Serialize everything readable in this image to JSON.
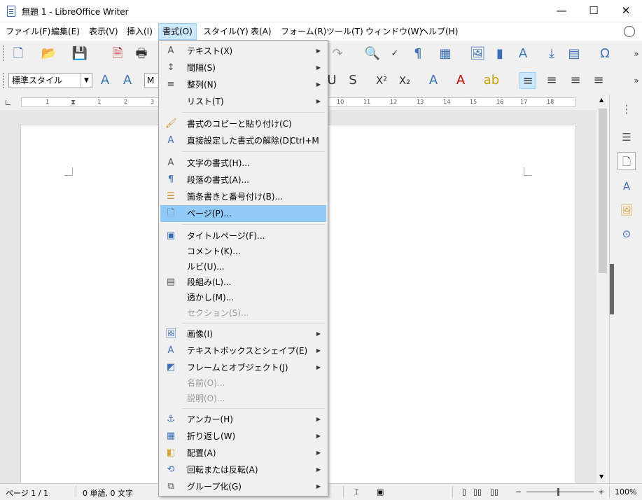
{
  "window": {
    "title": "無題 1 - LibreOffice Writer",
    "minimize": "—",
    "maximize": "☐",
    "close": "✕"
  },
  "menubar": [
    {
      "label": "ファイル(F)"
    },
    {
      "label": "編集(E)"
    },
    {
      "label": "表示(V)"
    },
    {
      "label": "挿入(I)"
    },
    {
      "label": "書式(O)"
    },
    {
      "label": "スタイル(Y)"
    },
    {
      "label": "表(A)"
    },
    {
      "label": "フォーム(R)"
    },
    {
      "label": "ツール(T)"
    },
    {
      "label": "ウィンドウ(W)"
    },
    {
      "label": "ヘルプ(H)"
    }
  ],
  "toolbar2": {
    "paragraph_style": "標準スタイル",
    "font_name": "M"
  },
  "ruler": {
    "numbers": [
      "1",
      "1",
      "2",
      "3",
      "10",
      "11",
      "12",
      "13",
      "14",
      "15",
      "16",
      "17",
      "18"
    ]
  },
  "format_menu": {
    "items": [
      {
        "icon": "text-icon",
        "glyph": "A",
        "label": "テキスト(X)",
        "submenu": true
      },
      {
        "icon": "spacing-icon",
        "glyph": "↕",
        "label": "間隔(S)",
        "submenu": true
      },
      {
        "icon": "align-icon",
        "glyph": "≡",
        "label": "整列(N)",
        "submenu": true
      },
      {
        "icon": "list-icon",
        "glyph": "",
        "label": "リスト(T)",
        "submenu": true
      },
      {
        "icon": "clone-formatting-icon",
        "glyph": "🖌",
        "label": "書式のコピーと貼り付け(C)"
      },
      {
        "icon": "clear-formatting-icon",
        "glyph": "A",
        "label": "直接設定した書式の解除(D)",
        "shortcut": "Ctrl+M"
      },
      {
        "icon": "character-icon",
        "glyph": "A",
        "label": "文字の書式(H)..."
      },
      {
        "icon": "paragraph-icon",
        "glyph": "¶",
        "label": "段落の書式(A)..."
      },
      {
        "icon": "bullets-numbering-icon",
        "glyph": "☰",
        "label": "箇条書きと番号付け(B)..."
      },
      {
        "icon": "page-icon",
        "glyph": "🗋",
        "label": "ページ(P)...",
        "highlight": true
      },
      {
        "icon": "title-page-icon",
        "glyph": "▣",
        "label": "タイトルページ(F)..."
      },
      {
        "icon": "",
        "glyph": "",
        "label": "コメント(K)..."
      },
      {
        "icon": "",
        "glyph": "",
        "label": "ルビ(U)..."
      },
      {
        "icon": "columns-icon",
        "glyph": "▤",
        "label": "段組み(L)..."
      },
      {
        "icon": "",
        "glyph": "",
        "label": "透かし(M)..."
      },
      {
        "icon": "",
        "glyph": "",
        "label": "セクション(S)...",
        "disabled": true
      },
      {
        "icon": "image-icon",
        "glyph": "🖼",
        "label": "画像(I)",
        "submenu": true
      },
      {
        "icon": "textbox-icon",
        "glyph": "A",
        "label": "テキストボックスとシェイプ(E)",
        "submenu": true
      },
      {
        "icon": "frame-icon",
        "glyph": "◩",
        "label": "フレームとオブジェクト(J)",
        "submenu": true
      },
      {
        "icon": "",
        "glyph": "",
        "label": "名前(O)...",
        "disabled": true
      },
      {
        "icon": "",
        "glyph": "",
        "label": "説明(O)...",
        "disabled": true
      },
      {
        "icon": "anchor-icon",
        "glyph": "⚓",
        "label": "アンカー(H)",
        "submenu": true
      },
      {
        "icon": "wrap-icon",
        "glyph": "▦",
        "label": "折り返し(W)",
        "submenu": true
      },
      {
        "icon": "arrange-icon",
        "glyph": "◧",
        "label": "配置(A)",
        "submenu": true
      },
      {
        "icon": "rotate-flip-icon",
        "glyph": "⟲",
        "label": "回転または反転(A)",
        "submenu": true
      },
      {
        "icon": "group-icon",
        "glyph": "⧉",
        "label": "グループ化(G)",
        "submenu": true
      }
    ]
  },
  "statusbar": {
    "page": "ページ 1 / 1",
    "words": "0 単語, 0 文字",
    "zoom_minus": "−",
    "zoom_plus": "+",
    "zoom": "100%"
  },
  "colors": {
    "menu_highlight": "#91c9f7",
    "menubar_active": "#cce8ff",
    "accent_blue": "#3a6fb5",
    "font_color_red": "#c00000",
    "highlight_yellow": "#ffe000"
  }
}
